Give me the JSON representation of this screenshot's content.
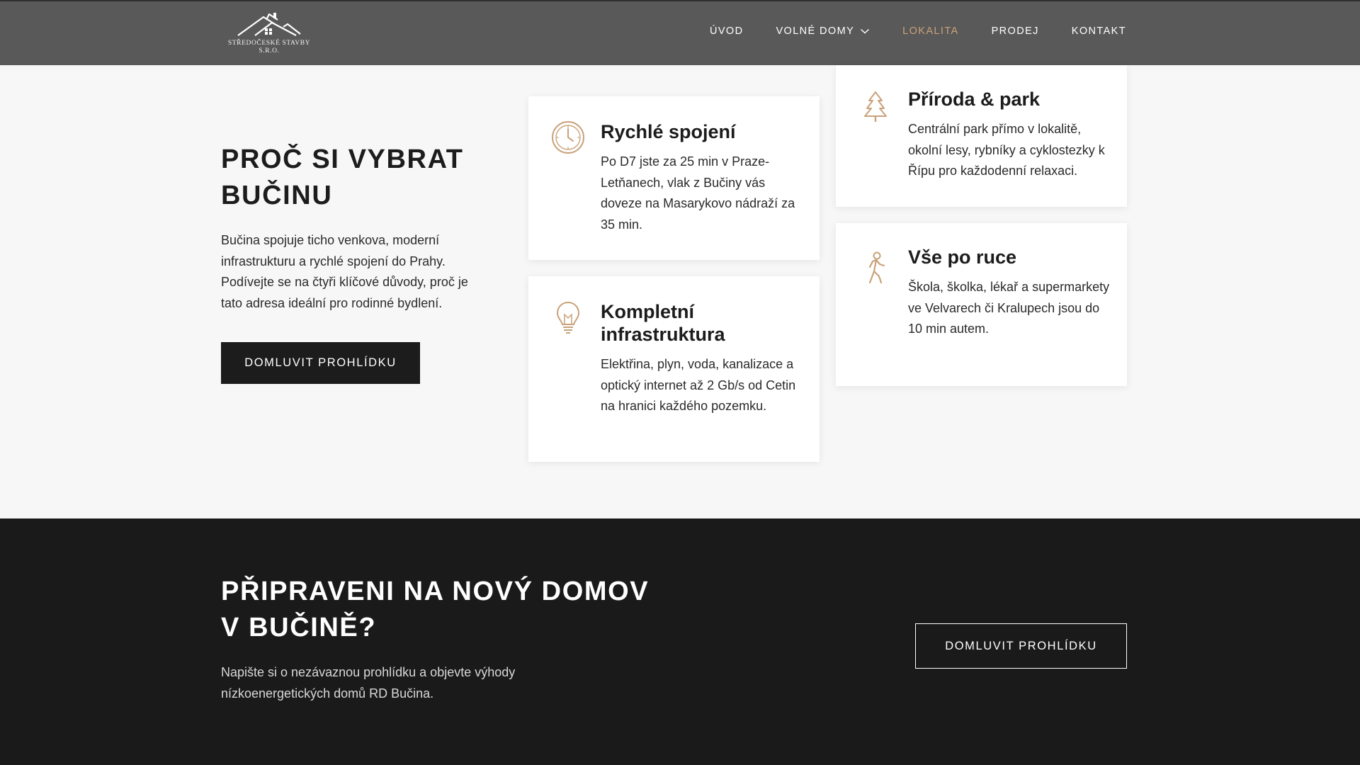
{
  "header": {
    "logo_text_line1": "STŘEDOČESKÉ STAVBY",
    "logo_text_line2": "S.R.O.",
    "nav": [
      {
        "label": "ÚVOD"
      },
      {
        "label": "VOLNÉ DOMY",
        "dropdown": true
      },
      {
        "label": "LOKALITA",
        "active": true
      },
      {
        "label": "PRODEJ"
      },
      {
        "label": "KONTAKT"
      }
    ]
  },
  "why": {
    "title_line1": "PROČ SI VYBRAT",
    "title_line2": "BUČINU",
    "text": "Bučina spojuje ticho venkova, moderní infrastrukturu a rychlé spojení do Prahy. Podívejte se na čtyři klíčové důvody, proč je tato adresa ideální pro rodinné bydlení.",
    "button_label": "DOMLUVIT PROHLÍDKU"
  },
  "cards": [
    {
      "icon": "clock-icon",
      "title": "Rychlé spojení",
      "text": "Po D7 jste za 25 min v Praze-Letňanech, vlak z Bučiny vás doveze na Masarykovo nádraží za 35 min."
    },
    {
      "icon": "lightbulb-icon",
      "title": "Kompletní infrastruktura",
      "text": "Elektřina, plyn, voda, kanalizace a optický internet až 2 Gb/s od Cetin na hranici každého pozemku."
    },
    {
      "icon": "tree-icon",
      "title": "Příroda & park",
      "text": "Centrální park přímo v lokalitě, okolní lesy, rybníky a cyklostezky k Řípu pro každodenní relaxaci."
    },
    {
      "icon": "walking-person-icon",
      "title": "Vše po ruce",
      "text": "Škola, školka, lékař a supermarkety ve Velvarech či Kralupech jsou do 10 min autem."
    }
  ],
  "cta": {
    "title_line1": "PŘIPRAVENI NA NOVÝ DOMOV",
    "title_line2": "V BUČINĚ?",
    "text": "Napište si o nezávaznou prohlídku a objevte výhody nízkoenergetických domů RD Bučina.",
    "button_label": "DOMLUVIT PROHLÍDKU"
  },
  "colors": {
    "header_bg": "#595959",
    "accent": "#c9a27a",
    "dark": "#1c1c1c",
    "section_bg": "#f7f7f7"
  }
}
